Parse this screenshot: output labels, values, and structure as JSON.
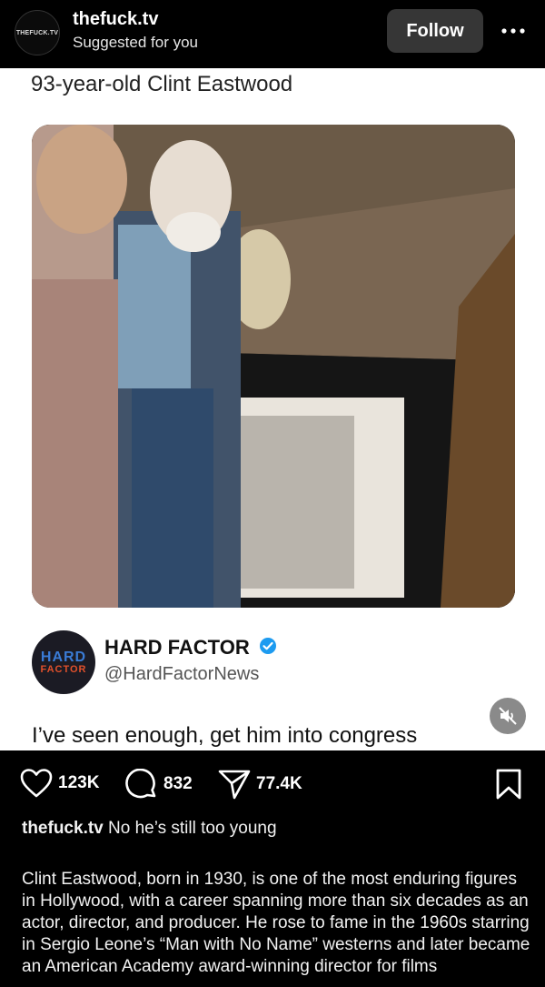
{
  "header": {
    "avatar_text": "THEFUCK.TV",
    "account": "thefuck.tv",
    "subtitle": "Suggested for you",
    "follow_label": "Follow",
    "more_icon": "more-horizontal-icon"
  },
  "post": {
    "title": "93-year-old Clint Eastwood",
    "quote": {
      "avatar_line1": "HARD",
      "avatar_line2": "FACTOR",
      "name": "HARD FACTOR",
      "handle": "@HardFactorNews",
      "text": "I’ve seen enough, get him into congress"
    }
  },
  "actions": {
    "likes": "123K",
    "comments": "832",
    "shares": "77.4K"
  },
  "caption": {
    "user": "thefuck.tv",
    "text": "No he’s still too young"
  },
  "description": "Clint Eastwood, born in 1930, is one of the most enduring figures in Hollywood, with a career spanning more than six decades as an actor, director, and producer. He rose to fame in the 1960s starring in Sergio Leone’s “Man with No Name” westerns and later became an American Academy award-winning director for films"
}
